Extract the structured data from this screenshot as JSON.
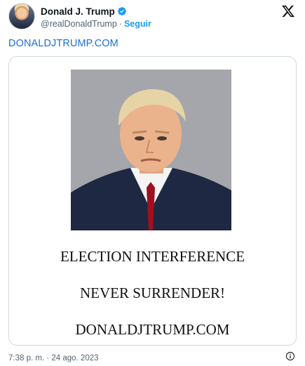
{
  "author": {
    "display_name": "Donald J. Trump",
    "handle": "@realDonaldTrump",
    "separator": "·",
    "follow_label": "Seguir",
    "verified_icon": "verified-badge-icon"
  },
  "tweet": {
    "link_text": "DONALDJTRUMP.COM"
  },
  "media": {
    "photo_description_icon": "mugshot-photo",
    "lines": [
      "ELECTION INTERFERENCE",
      "NEVER SURRENDER!",
      "DONALDJTRUMP.COM"
    ]
  },
  "footer": {
    "timestamp": "7:38 p. m. · 24 ago. 2023",
    "info_icon": "info-icon"
  },
  "colors": {
    "accent": "#1d9bf0",
    "link": "#1d6fd6",
    "secondary_text": "#536471",
    "border": "#cfd9de"
  }
}
